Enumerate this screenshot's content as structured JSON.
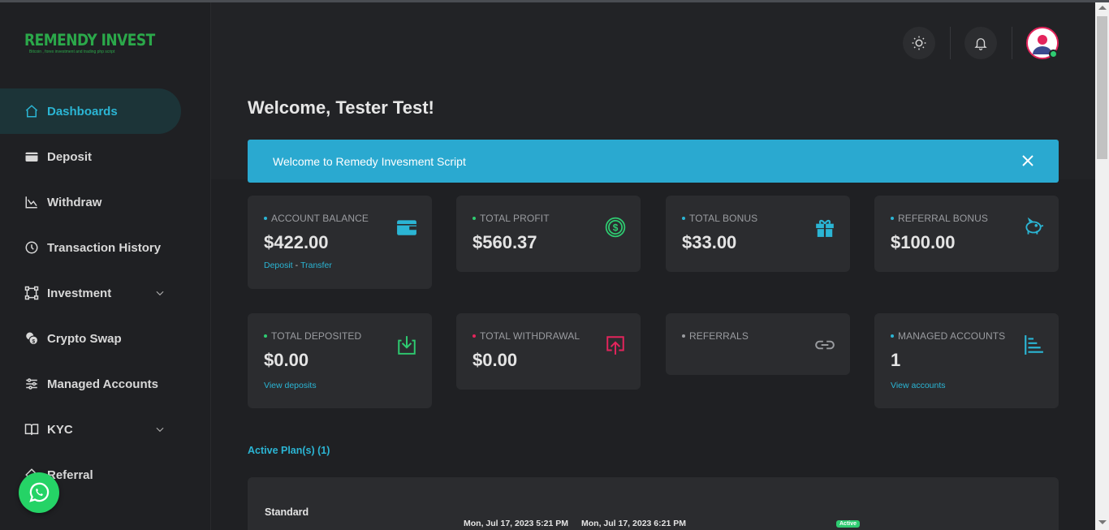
{
  "brand": {
    "name": "REMENDY INVEST",
    "tagline": "Bitcoin , forex investment and trading php script"
  },
  "sidebar": {
    "items": [
      {
        "label": "Dashboards",
        "icon": "home-icon",
        "active": true
      },
      {
        "label": "Deposit",
        "icon": "wallet-icon"
      },
      {
        "label": "Withdraw",
        "icon": "chart-icon"
      },
      {
        "label": "Transaction History",
        "icon": "clock-icon"
      },
      {
        "label": "Investment",
        "icon": "frame-icon",
        "expandable": true
      },
      {
        "label": "Crypto Swap",
        "icon": "coins-icon"
      },
      {
        "label": "Managed Accounts",
        "icon": "sliders-icon"
      },
      {
        "label": "KYC",
        "icon": "book-icon",
        "expandable": true
      },
      {
        "label": "Referral",
        "icon": "share-icon"
      }
    ]
  },
  "header": {
    "theme_toggle_icon": "sun-icon",
    "notifications_icon": "bell-icon",
    "avatar_icon": "user-avatar-icon"
  },
  "page": {
    "welcome": "Welcome, Tester Test!",
    "alert": "Welcome to Remedy Invesment Script"
  },
  "cards": [
    {
      "label": "ACCOUNT BALANCE",
      "value": "$422.00",
      "dot_color": "#2bb5d4",
      "icon": "wallet-icon",
      "icon_color": "#2bb5d4",
      "links": [
        "Deposit",
        "Transfer"
      ]
    },
    {
      "label": "TOTAL PROFIT",
      "value": "$560.37",
      "dot_color": "#2ecc71",
      "icon": "dollar-coin-icon",
      "icon_color": "#2ecc71"
    },
    {
      "label": "TOTAL BONUS",
      "value": "$33.00",
      "dot_color": "#2bb5d4",
      "icon": "gift-icon",
      "icon_color": "#2bb5d4"
    },
    {
      "label": "REFERRAL BONUS",
      "value": "$100.00",
      "dot_color": "#2bb5d4",
      "icon": "piggy-bank-icon",
      "icon_color": "#2bb5d4"
    },
    {
      "label": "TOTAL DEPOSITED",
      "value": "$0.00",
      "dot_color": "#2ecc71",
      "icon": "download-icon",
      "icon_color": "#2ecc71",
      "links": [
        "View deposits"
      ]
    },
    {
      "label": "TOTAL WITHDRAWAL",
      "value": "$0.00",
      "dot_color": "#e4245c",
      "icon": "upload-icon",
      "icon_color": "#e4245c"
    },
    {
      "label": "REFERRALS",
      "value": "",
      "dot_color": "#9a9ca0",
      "icon": "link-icon",
      "icon_color": "#9a9ca0"
    },
    {
      "label": "MANAGED ACCOUNTS",
      "value": "1",
      "dot_color": "#2bb5d4",
      "icon": "list-tree-icon",
      "icon_color": "#2bb5d4",
      "links": [
        "View accounts"
      ]
    }
  ],
  "plans": {
    "title": "Active Plan(s) (1)",
    "items": [
      {
        "name": "Standard",
        "start": "Mon, Jul 17, 2023 5:21 PM",
        "end": "Mon, Jul 17, 2023 6:21 PM",
        "status": "Active"
      }
    ]
  },
  "colors": {
    "accent": "#2bb5d4",
    "alert_bg": "#2aa9d0",
    "success": "#2ecc71",
    "danger": "#e4245c",
    "brand_green": "#2ba84a"
  }
}
